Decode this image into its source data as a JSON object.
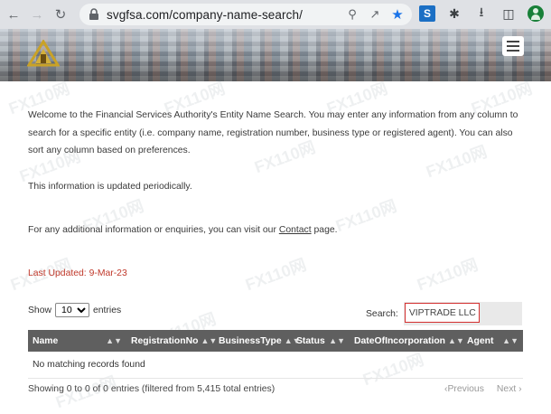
{
  "browser": {
    "url": "svgfsa.com/company-name-search/",
    "ext_s_label": "S"
  },
  "intro": {
    "paragraph": "Welcome to the Financial Services Authority's Entity Name Search. You may enter any information from any column to search for a specific entity (i.e. company name, registration number, business type or registered agent). You can also sort any column based on preferences.",
    "updated_note": "This information is updated periodically.",
    "contact_prefix": "For any additional information or enquiries, you can visit our ",
    "contact_link": "Contact",
    "contact_suffix": " page.",
    "last_updated": "Last Updated:  9-Mar-23"
  },
  "controls": {
    "show_label": "Show",
    "show_value": "10",
    "entries_label": "entries",
    "search_label": "Search:",
    "search_value": "VIPTRADE LLC"
  },
  "table": {
    "columns": [
      "Name",
      "RegistrationNo",
      "BusinessType",
      "Status",
      "DateOfIncorporation",
      "Agent"
    ],
    "empty_message": "No matching records found"
  },
  "footer": {
    "info": "Showing 0 to 0 of 0 entries (filtered from 5,415 total entries)",
    "previous": "Previous",
    "next": "Next"
  },
  "colors": {
    "header_bg": "#5f5f5f",
    "updated_red": "#c0392b",
    "search_highlight": "#d32f2f",
    "bookmark_blue": "#1a73e8"
  },
  "watermark_text": "FX110网"
}
